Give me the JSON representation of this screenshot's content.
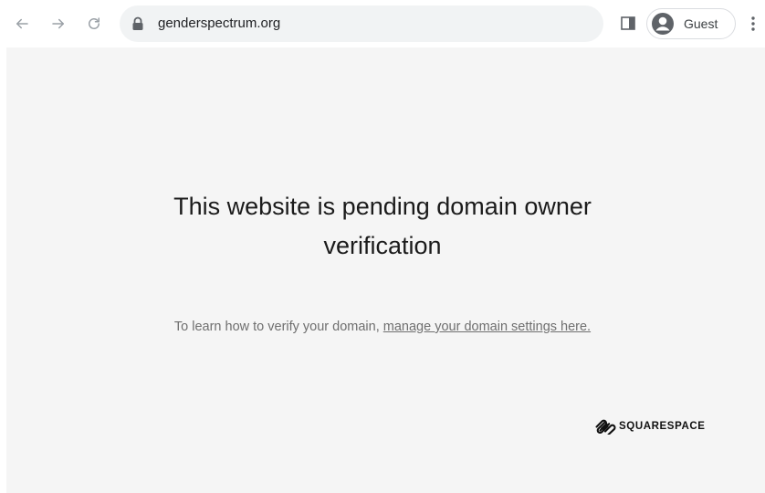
{
  "browser": {
    "nav": {
      "back_icon": "arrow-left-icon",
      "forward_icon": "arrow-right-icon",
      "reload_icon": "reload-icon"
    },
    "omnibox": {
      "lock_icon": "lock-icon",
      "url": "genderspectrum.org"
    },
    "side_panel_icon": "side-panel-icon",
    "profile": {
      "avatar_icon": "account-circle-icon",
      "label": "Guest"
    },
    "menu_icon": "more-vertical-icon"
  },
  "page": {
    "background": "#f5f5f5",
    "headline_line1": "This website is pending domain owner",
    "headline_line2": "verification",
    "instruction_text": "To learn how to verify your domain, ",
    "instruction_link": "manage your domain settings here.",
    "brand": {
      "logo_icon": "squarespace-logo-icon",
      "name": "SQUARESPACE"
    }
  }
}
